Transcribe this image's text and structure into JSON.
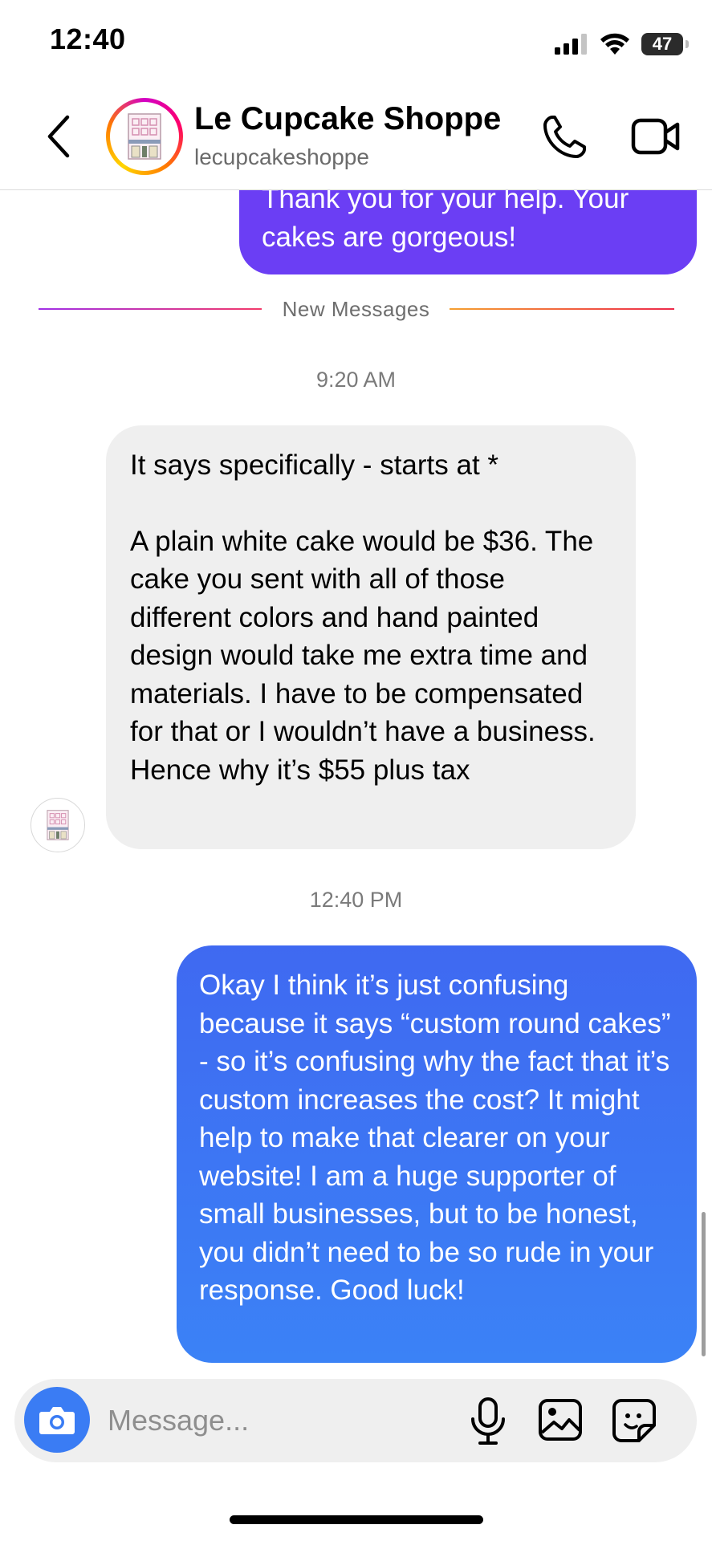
{
  "status_bar": {
    "time": "12:40",
    "battery": "47",
    "icons": [
      "cellular-signal-icon",
      "wifi-icon",
      "battery-icon"
    ]
  },
  "header": {
    "contact_name": "Le Cupcake Shoppe",
    "contact_handle": "lecupcakeshoppe",
    "icons": [
      "back-chevron-icon",
      "phone-icon",
      "video-camera-icon"
    ],
    "avatar_ring_colors": [
      "#d300c5",
      "#ff0069",
      "#ff7a00",
      "#ffd600"
    ]
  },
  "thread": {
    "previous_outgoing": "Thank you for your help. Your cakes are gorgeous!",
    "new_messages_label": "New Messages",
    "timestamp_1": "9:20 AM",
    "incoming_message": {
      "paragraph_1": "It says specifically - starts at *",
      "paragraph_2": "A plain white cake would be $36. The cake you sent with all of those different colors and hand painted design would take me extra time and materials. I have to be compensated for that or I wouldn’t have a business. Hence why it’s $55 plus tax"
    },
    "timestamp_2": "12:40 PM",
    "outgoing_message": "Okay I think it’s just confusing because it says “custom round cakes” - so it’s confusing why the fact that it’s custom increases the cost? It might help to make that clearer on your website! I am a huge supporter of small businesses, but to be honest, you didn’t need to be so rude in your response. Good luck!"
  },
  "composer": {
    "placeholder": "Message...",
    "icons": [
      "camera-icon",
      "microphone-icon",
      "gallery-icon",
      "sticker-icon"
    ]
  },
  "colors": {
    "outgoing_prev_bubble": "#6b3ef4",
    "outgoing_bubble_top": "#3f69f1",
    "outgoing_bubble_bottom": "#3b82f6",
    "incoming_bubble": "#efefef",
    "camera_button": "#3a7cf4"
  }
}
